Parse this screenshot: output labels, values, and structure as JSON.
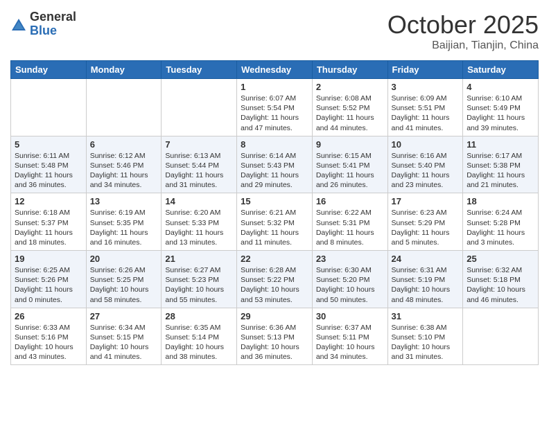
{
  "header": {
    "logo_general": "General",
    "logo_blue": "Blue",
    "month": "October 2025",
    "location": "Baijian, Tianjin, China"
  },
  "days_of_week": [
    "Sunday",
    "Monday",
    "Tuesday",
    "Wednesday",
    "Thursday",
    "Friday",
    "Saturday"
  ],
  "weeks": [
    [
      {
        "day": "",
        "info": ""
      },
      {
        "day": "",
        "info": ""
      },
      {
        "day": "",
        "info": ""
      },
      {
        "day": "1",
        "info": "Sunrise: 6:07 AM\nSunset: 5:54 PM\nDaylight: 11 hours\nand 47 minutes."
      },
      {
        "day": "2",
        "info": "Sunrise: 6:08 AM\nSunset: 5:52 PM\nDaylight: 11 hours\nand 44 minutes."
      },
      {
        "day": "3",
        "info": "Sunrise: 6:09 AM\nSunset: 5:51 PM\nDaylight: 11 hours\nand 41 minutes."
      },
      {
        "day": "4",
        "info": "Sunrise: 6:10 AM\nSunset: 5:49 PM\nDaylight: 11 hours\nand 39 minutes."
      }
    ],
    [
      {
        "day": "5",
        "info": "Sunrise: 6:11 AM\nSunset: 5:48 PM\nDaylight: 11 hours\nand 36 minutes."
      },
      {
        "day": "6",
        "info": "Sunrise: 6:12 AM\nSunset: 5:46 PM\nDaylight: 11 hours\nand 34 minutes."
      },
      {
        "day": "7",
        "info": "Sunrise: 6:13 AM\nSunset: 5:44 PM\nDaylight: 11 hours\nand 31 minutes."
      },
      {
        "day": "8",
        "info": "Sunrise: 6:14 AM\nSunset: 5:43 PM\nDaylight: 11 hours\nand 29 minutes."
      },
      {
        "day": "9",
        "info": "Sunrise: 6:15 AM\nSunset: 5:41 PM\nDaylight: 11 hours\nand 26 minutes."
      },
      {
        "day": "10",
        "info": "Sunrise: 6:16 AM\nSunset: 5:40 PM\nDaylight: 11 hours\nand 23 minutes."
      },
      {
        "day": "11",
        "info": "Sunrise: 6:17 AM\nSunset: 5:38 PM\nDaylight: 11 hours\nand 21 minutes."
      }
    ],
    [
      {
        "day": "12",
        "info": "Sunrise: 6:18 AM\nSunset: 5:37 PM\nDaylight: 11 hours\nand 18 minutes."
      },
      {
        "day": "13",
        "info": "Sunrise: 6:19 AM\nSunset: 5:35 PM\nDaylight: 11 hours\nand 16 minutes."
      },
      {
        "day": "14",
        "info": "Sunrise: 6:20 AM\nSunset: 5:33 PM\nDaylight: 11 hours\nand 13 minutes."
      },
      {
        "day": "15",
        "info": "Sunrise: 6:21 AM\nSunset: 5:32 PM\nDaylight: 11 hours\nand 11 minutes."
      },
      {
        "day": "16",
        "info": "Sunrise: 6:22 AM\nSunset: 5:31 PM\nDaylight: 11 hours\nand 8 minutes."
      },
      {
        "day": "17",
        "info": "Sunrise: 6:23 AM\nSunset: 5:29 PM\nDaylight: 11 hours\nand 5 minutes."
      },
      {
        "day": "18",
        "info": "Sunrise: 6:24 AM\nSunset: 5:28 PM\nDaylight: 11 hours\nand 3 minutes."
      }
    ],
    [
      {
        "day": "19",
        "info": "Sunrise: 6:25 AM\nSunset: 5:26 PM\nDaylight: 11 hours\nand 0 minutes."
      },
      {
        "day": "20",
        "info": "Sunrise: 6:26 AM\nSunset: 5:25 PM\nDaylight: 10 hours\nand 58 minutes."
      },
      {
        "day": "21",
        "info": "Sunrise: 6:27 AM\nSunset: 5:23 PM\nDaylight: 10 hours\nand 55 minutes."
      },
      {
        "day": "22",
        "info": "Sunrise: 6:28 AM\nSunset: 5:22 PM\nDaylight: 10 hours\nand 53 minutes."
      },
      {
        "day": "23",
        "info": "Sunrise: 6:30 AM\nSunset: 5:20 PM\nDaylight: 10 hours\nand 50 minutes."
      },
      {
        "day": "24",
        "info": "Sunrise: 6:31 AM\nSunset: 5:19 PM\nDaylight: 10 hours\nand 48 minutes."
      },
      {
        "day": "25",
        "info": "Sunrise: 6:32 AM\nSunset: 5:18 PM\nDaylight: 10 hours\nand 46 minutes."
      }
    ],
    [
      {
        "day": "26",
        "info": "Sunrise: 6:33 AM\nSunset: 5:16 PM\nDaylight: 10 hours\nand 43 minutes."
      },
      {
        "day": "27",
        "info": "Sunrise: 6:34 AM\nSunset: 5:15 PM\nDaylight: 10 hours\nand 41 minutes."
      },
      {
        "day": "28",
        "info": "Sunrise: 6:35 AM\nSunset: 5:14 PM\nDaylight: 10 hours\nand 38 minutes."
      },
      {
        "day": "29",
        "info": "Sunrise: 6:36 AM\nSunset: 5:13 PM\nDaylight: 10 hours\nand 36 minutes."
      },
      {
        "day": "30",
        "info": "Sunrise: 6:37 AM\nSunset: 5:11 PM\nDaylight: 10 hours\nand 34 minutes."
      },
      {
        "day": "31",
        "info": "Sunrise: 6:38 AM\nSunset: 5:10 PM\nDaylight: 10 hours\nand 31 minutes."
      },
      {
        "day": "",
        "info": ""
      }
    ]
  ]
}
